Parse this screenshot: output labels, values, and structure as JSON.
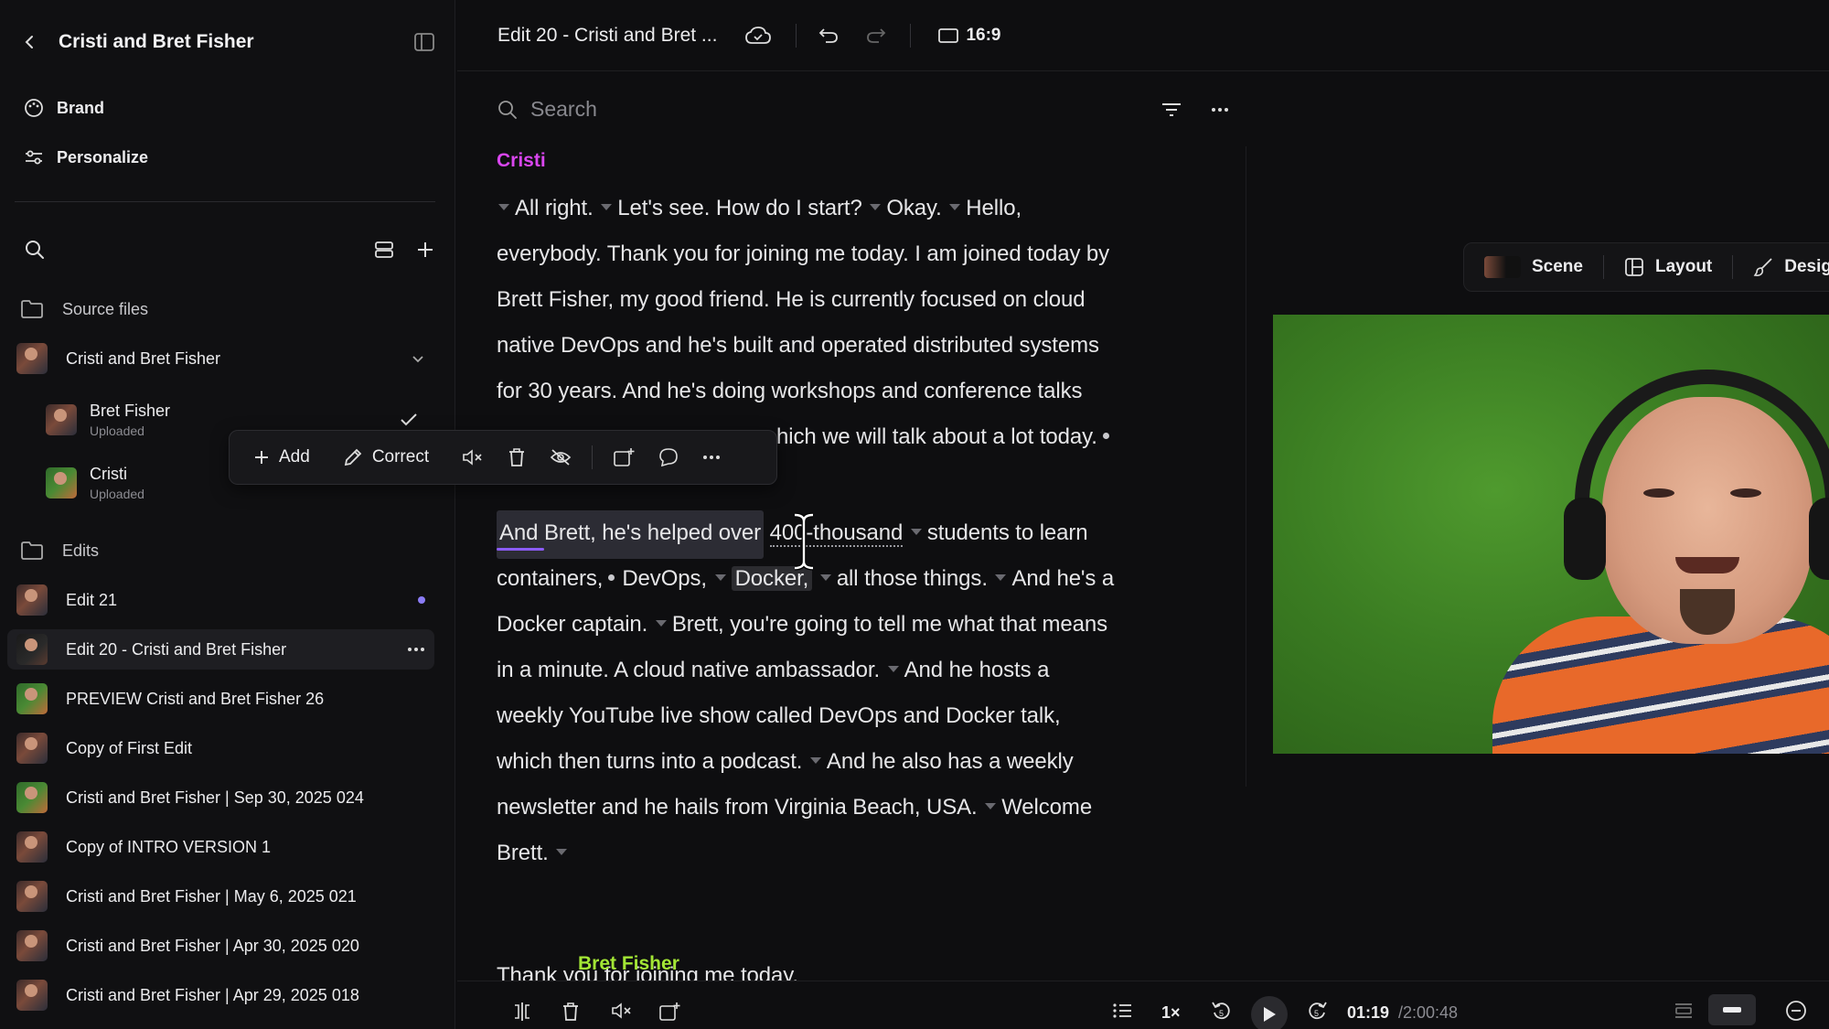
{
  "sidebar": {
    "project_title": "Cristi and Bret Fisher",
    "top_items": [
      {
        "label": "Brand",
        "icon": "palette-icon"
      },
      {
        "label": "Personalize",
        "icon": "sliders-icon"
      }
    ],
    "source_files_label": "Source files",
    "source_group": "Cristi and Bret Fisher",
    "source_children": [
      {
        "name": "Bret Fisher",
        "status": "Uploaded"
      },
      {
        "name": "Cristi",
        "status": "Uploaded"
      }
    ],
    "edits_label": "Edits",
    "edits": [
      "Edit 21",
      "Edit 20 - Cristi and Bret Fisher",
      "PREVIEW Cristi and Bret Fisher 26",
      "Copy of First Edit",
      "Cristi and Bret Fisher | Sep 30, 2025 024",
      "Copy of INTRO VERSION 1",
      "Cristi and Bret Fisher | May 6, 2025 021",
      "Cristi and Bret Fisher | Apr 30, 2025 020",
      "Cristi and Bret Fisher | Apr 29, 2025 018"
    ]
  },
  "topbar": {
    "doc_title": "Edit 20 - Cristi and Bret ...",
    "aspect_ratio": "16:9"
  },
  "transcript": {
    "search_placeholder": "Search",
    "speaker1": "Cristi",
    "speaker1_color": "#d946ef",
    "p1": {
      "l1a": "All right.",
      "l1b": "Let's see. How do I start?",
      "l1c": "Okay.",
      "l1d": "Hello,",
      "l2": "everybody. Thank you for joining me today. I am joined today by",
      "l3": "Brett Fisher, my good friend. He is currently focused on cloud",
      "l4": "native DevOps and he's built and operated distributed systems",
      "l5": "for 30 years. And he's doing workshops and conference talks",
      "l6": "hich we will talk about a lot today."
    },
    "p2": {
      "l1a": "And Brett, he's helped over",
      "l1b": "400-thousand",
      "l1c": "students to learn",
      "l2a": "containers,",
      "l2b": "DevOps,",
      "l2c": "Docker,",
      "l2d": "all those things.",
      "l2e": "And he's a",
      "l3a": "Docker captain.",
      "l3b": "Brett, you're going to tell me what that means",
      "l4a": "in a minute. A cloud native ambassador.",
      "l4b": "And he hosts a",
      "l5": "weekly YouTube live show called DevOps and Docker talk,",
      "l6a": "which then turns into a podcast.",
      "l6b": "And he also has a weekly",
      "l7a": "newsletter and he hails from Virginia Beach, USA.",
      "l7b": "Welcome",
      "l8": "Brett."
    },
    "p3": "Thank you for joining me today.",
    "speaker2": "Bret Fisher",
    "speaker2_color": "#a3e635"
  },
  "edit_toolbar": {
    "add_label": "Add",
    "correct_label": "Correct"
  },
  "preview": {
    "tabs": [
      "Scene",
      "Layout",
      "Desig"
    ]
  },
  "playback": {
    "speed": "1×",
    "current_time": "01:19",
    "total_time": "/2:00:48",
    "skip_back": "5",
    "skip_forward": "5"
  }
}
